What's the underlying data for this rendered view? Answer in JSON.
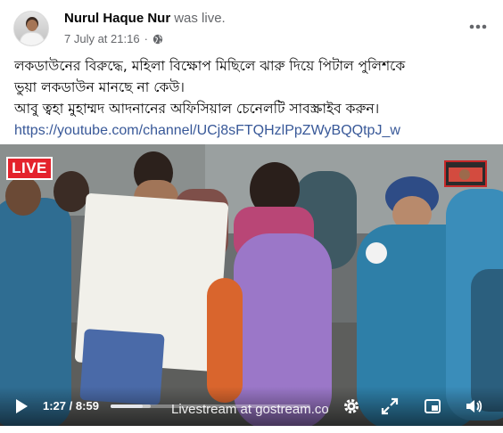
{
  "post": {
    "author_name": "Nurul Haque Nur",
    "author_action": "was live.",
    "date": "7 July at 21:16",
    "separator": "·",
    "privacy_icon": "globe-icon",
    "more_icon": "more-horizontal-icon",
    "text_lines": [
      "লকডাউনের বিরুদ্ধে, মহিলা বিক্ষোপ মিছিলে  ঝারু দিয়ে পিটাল পুলিশকে",
      "ভুয়া লকডাউন মানছে না কেউ।",
      "আবু ত্বহা মুহাম্মদ আদনানের অফিসিয়াল চেনেলটি সাবস্ক্রাইব করুন।"
    ],
    "link": "https://youtube.com/channel/UCj8sFTQHzlPpZWyBQQtpJ_w"
  },
  "video": {
    "live_label": "LIVE",
    "watermark": "Livestream at gostream.co",
    "current_time": "1:27",
    "time_separator": "/",
    "duration": "8:59",
    "progress_fraction": 0.161,
    "icons": [
      "play-icon",
      "settings-gear-icon",
      "fullscreen-icon",
      "picture-in-picture-icon",
      "volume-icon"
    ],
    "colors": {
      "live": "#e4222c",
      "police_blue": "#2e6f95",
      "banner_text": "#c0392b"
    }
  }
}
